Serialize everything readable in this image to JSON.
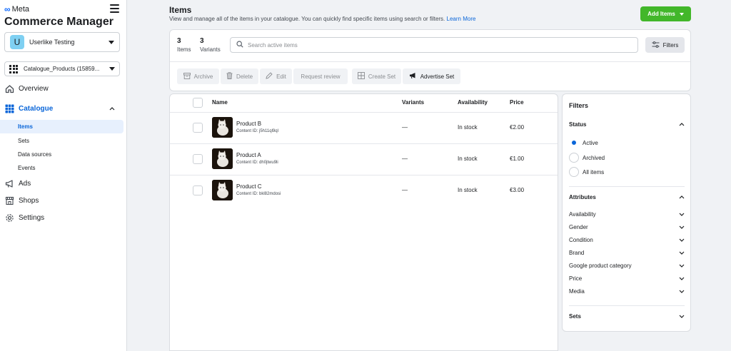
{
  "brand": {
    "logo_text": "Meta",
    "app_title": "Commerce Manager"
  },
  "account": {
    "initial": "U",
    "name": "Userlike Testing"
  },
  "catalogue_select": {
    "label": "Catalogue_Products (15859..."
  },
  "nav": {
    "overview": "Overview",
    "catalogue": "Catalogue",
    "catalogue_sub": [
      "Items",
      "Sets",
      "Data sources",
      "Events"
    ],
    "ads": "Ads",
    "shops": "Shops",
    "settings": "Settings"
  },
  "header": {
    "title": "Items",
    "description": "View and manage all of the items in your catalogue. You can quickly find specific items using search or filters.",
    "learn_more": "Learn More",
    "add_items": "Add Items"
  },
  "summary": {
    "items_count": "3",
    "items_label": "Items",
    "variants_count": "3",
    "variants_label": "Variants",
    "search_placeholder": "Search active items",
    "filters_button": "Filters"
  },
  "toolbar": {
    "archive": "Archive",
    "delete": "Delete",
    "edit": "Edit",
    "request_review": "Request review",
    "create_set": "Create Set",
    "advertise_set": "Advertise Set"
  },
  "table": {
    "columns": [
      "Name",
      "Variants",
      "Availability",
      "Price"
    ],
    "rows": [
      {
        "name": "Product B",
        "content_id": "Content ID: j5h11ql9ql",
        "variants": "—",
        "availability": "In stock",
        "price": "€2.00"
      },
      {
        "name": "Product A",
        "content_id": "Content ID: dh0jtwu9li",
        "variants": "—",
        "availability": "In stock",
        "price": "€1.00"
      },
      {
        "name": "Product C",
        "content_id": "Content ID: bkl82mdosi",
        "variants": "—",
        "availability": "In stock",
        "price": "€3.00"
      }
    ]
  },
  "filters_panel": {
    "title": "Filters",
    "status_label": "Status",
    "status_options": [
      "Active",
      "Archived",
      "All items"
    ],
    "status_selected": "Active",
    "attributes_label": "Attributes",
    "attributes": [
      "Availability",
      "Gender",
      "Condition",
      "Brand",
      "Google product category",
      "Price",
      "Media"
    ],
    "sets_label": "Sets"
  },
  "colors": {
    "accent": "#0a66d9",
    "add_button": "#42b72a",
    "active_bg": "#e7f0fd"
  }
}
